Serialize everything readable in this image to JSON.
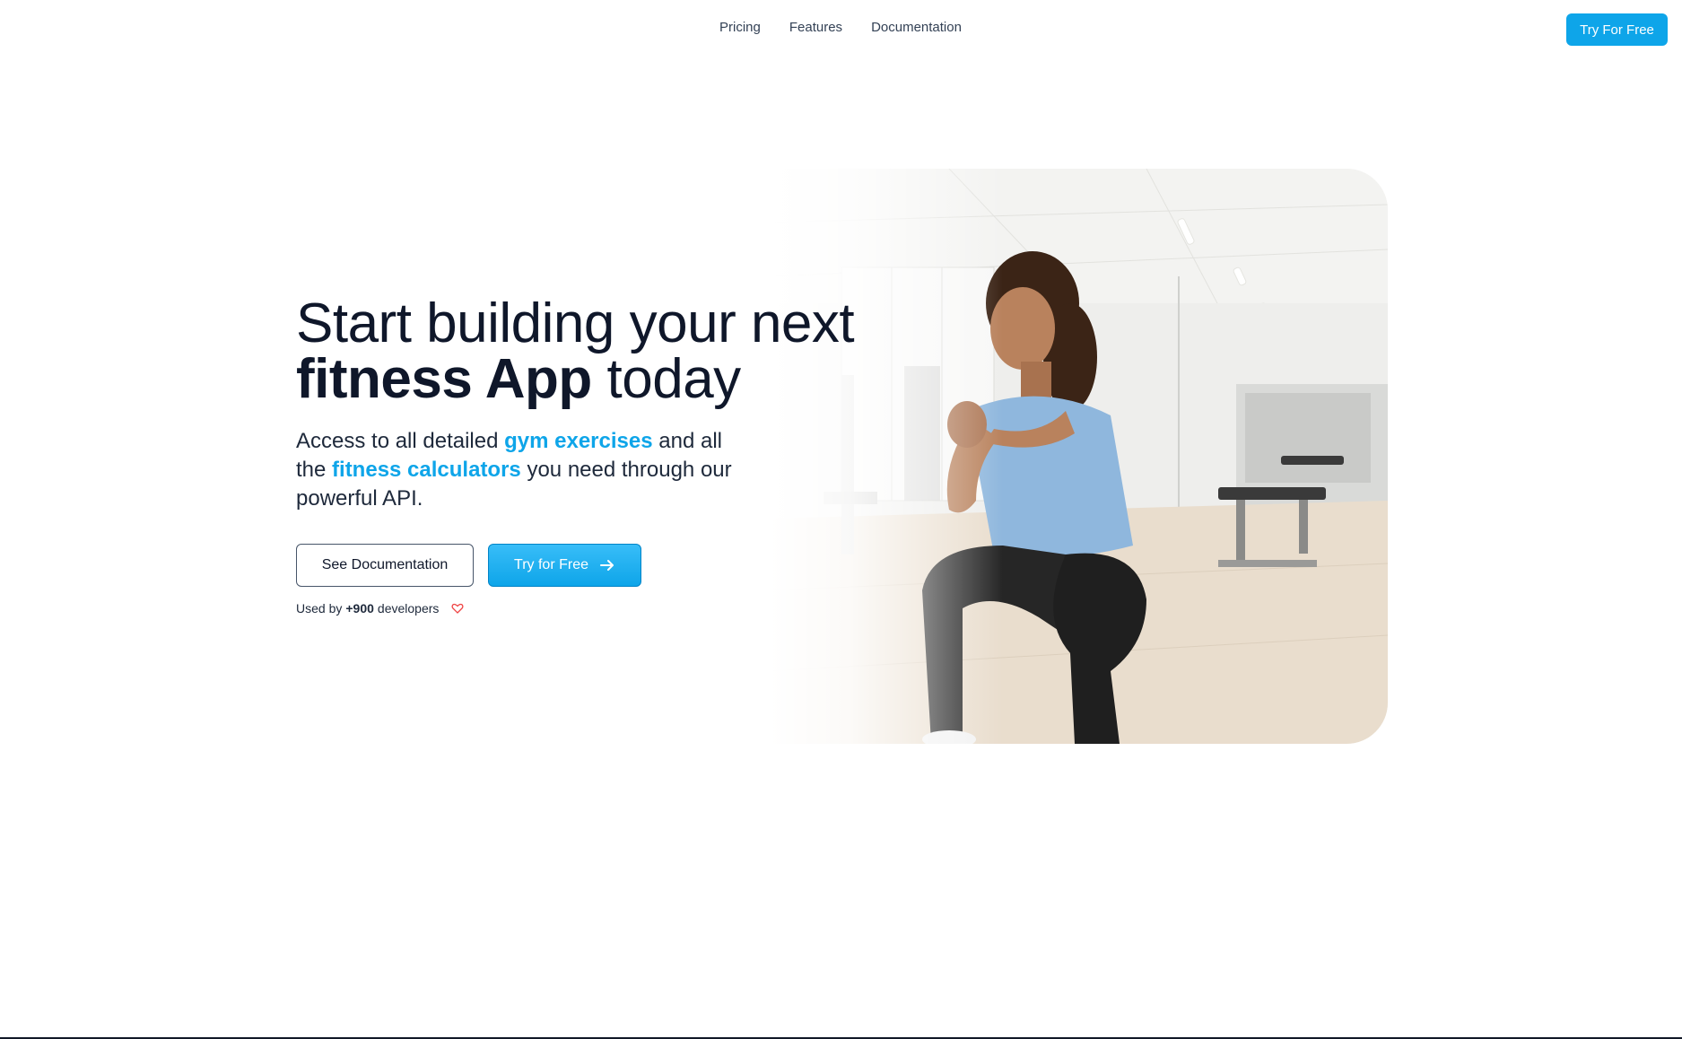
{
  "nav": {
    "links": [
      {
        "label": "Pricing"
      },
      {
        "label": "Features"
      },
      {
        "label": "Documentation"
      }
    ],
    "cta_label": "Try For Free"
  },
  "hero": {
    "headline_line1": "Start building your next",
    "headline_bold": "fitness App",
    "headline_rest": " today",
    "sub_part1": "Access to all detailed ",
    "sub_accent1": "gym exercises",
    "sub_part2": " and all the ",
    "sub_accent2": "fitness calculators",
    "sub_part3": " you need through our powerful API.",
    "secondary_button": "See Documentation",
    "primary_button": "Try for Free",
    "social_prefix": "Used by ",
    "social_count": "+900",
    "social_suffix": " developers",
    "image_icon": "woman-squatting-gym-photo"
  },
  "colors": {
    "accent": "#0ea5e9",
    "text": "#0f172a",
    "heart": "#ef4444"
  }
}
